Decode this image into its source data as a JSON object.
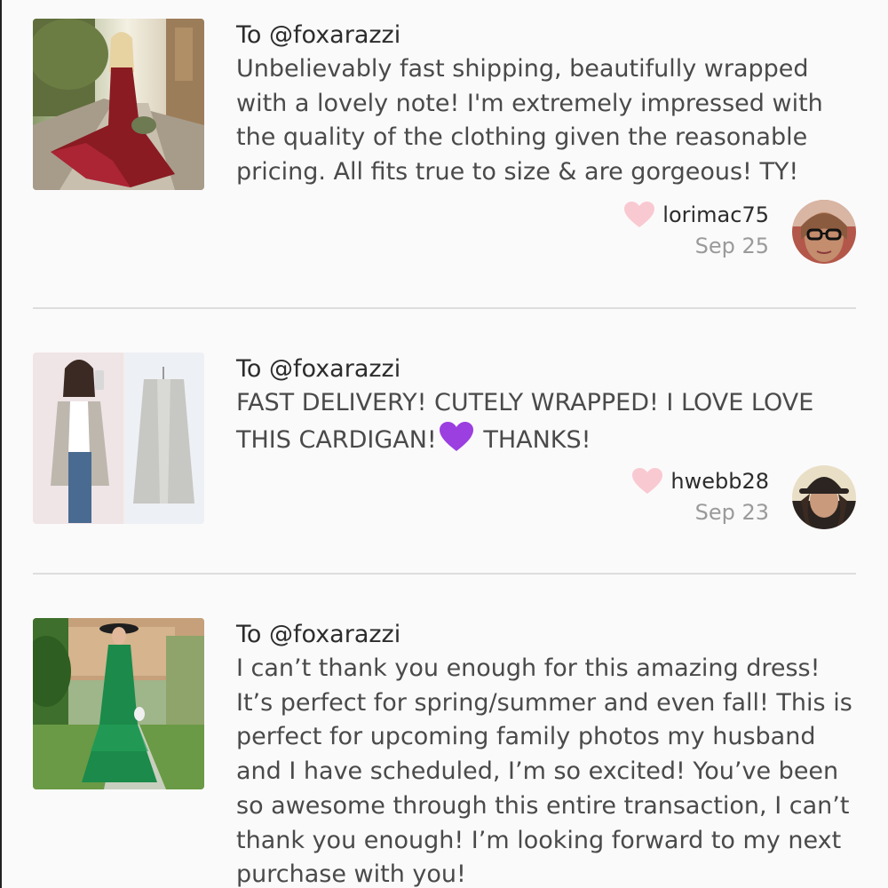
{
  "reviews": [
    {
      "to": "To @foxarazzi",
      "message_lines": [
        "Unbelievably fast shipping, beautifully wrapped",
        "with a lovely note! I'm extremely impressed with",
        "the quality of the clothing given the reasonable",
        "pricing. All fits true to size & are gorgeous! TY!"
      ],
      "username": "lorimac75",
      "date": "Sep 25",
      "photo": "red-lace-dress-photo",
      "avatar": "woman-with-glasses-avatar"
    },
    {
      "to": "To @foxarazzi",
      "message_lines": [
        "FAST DELIVERY! CUTELY WRAPPED! I LOVE LOVE",
        "THIS CARDIGAN!",
        "THANKS!"
      ],
      "emoji": "purple-heart-emoji",
      "username": "hwebb28",
      "date": "Sep 23",
      "photo": "gray-cardigan-photo",
      "avatar": "woman-with-hat-avatar"
    },
    {
      "to": "To @foxarazzi",
      "message_lines": [
        "I can’t thank you enough for this amazing dress!",
        "It’s perfect for spring/summer and even fall! This is",
        "perfect for upcoming family photos my husband",
        "and I have scheduled, I’m so excited! You’ve been",
        "so awesome through this entire transaction, I can’t",
        "thank you enough! I’m looking forward to my next",
        "purchase with you!"
      ],
      "photo": "green-maxi-dress-photo"
    }
  ],
  "colors": {
    "like_heart": "#f9c9d1",
    "emoji_heart": "#9b3fe0",
    "divider": "#dddddd",
    "date_text": "#9a9a9a"
  }
}
